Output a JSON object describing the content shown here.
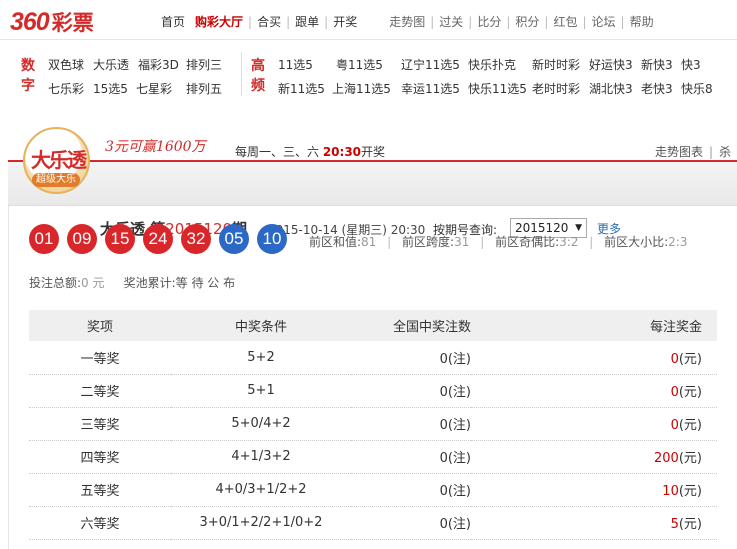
{
  "logo": {
    "num": "360",
    "text": "彩票"
  },
  "nav": [
    "首页",
    "购彩大厅",
    "合买",
    "跟单",
    "开奖",
    "走势图",
    "过关",
    "比分",
    "积分",
    "红包",
    "论坛",
    "帮助"
  ],
  "categories": {
    "digital_heading": "数字",
    "digital_row1": [
      "双色球",
      "大乐透",
      "福彩3D",
      "排列三"
    ],
    "digital_row2": [
      "七乐彩",
      "15选5",
      "七星彩",
      "排列五"
    ],
    "fast_heading": "高频",
    "fast_row1": [
      "11选5",
      "粤11选5",
      "辽宁11选5",
      "快乐扑克",
      "新时时彩",
      "好运快3",
      "新快3",
      "快3"
    ],
    "fast_row2": [
      "新11选5",
      "上海11选5",
      "幸运11选5",
      "快乐11选5",
      "老时时彩",
      "湖北快3",
      "老快3",
      "快乐8"
    ]
  },
  "header": {
    "badge_main": "大乐透",
    "badge_sub": "超级大乐",
    "slogan": "3元可赢1600万",
    "draw_days": "每周一、三、六 ",
    "draw_time": "20:30",
    "draw_suffix": "开奖",
    "trend": "走势图表",
    "trend_extra": "杀",
    "issue_prefix": "大乐透  第",
    "issue_no": "2015120",
    "issue_suffix": "期",
    "issue_date": "2015-10-14 (星期三) 20:30",
    "query_label": "按期号查询:",
    "query_value": "2015120",
    "more": "更多"
  },
  "draw": {
    "red_balls": [
      "01",
      "09",
      "15",
      "24",
      "32"
    ],
    "blue_balls": [
      "05",
      "10"
    ],
    "stats": {
      "sum_label": "前区和值:",
      "sum": "81",
      "span_label": "前区跨度:",
      "span": "31",
      "parity_label": "前区奇偶比:",
      "parity": "3:2",
      "size_label": "前区大小比:",
      "size": "2:3"
    },
    "sales_label": "投注总额:",
    "sales": "0 元",
    "pool_label": "奖池累计:",
    "pool": "等 待 公 布"
  },
  "prize_table": {
    "headers": [
      "奖项",
      "中奖条件",
      "全国中奖注数",
      "每注奖金"
    ],
    "rows": [
      {
        "level": "一等奖",
        "cond": "5+2",
        "count": "0",
        "count_unit": "(注)",
        "amount": "0",
        "amount_unit": "(元)"
      },
      {
        "level": "二等奖",
        "cond": "5+1",
        "count": "0",
        "count_unit": "(注)",
        "amount": "0",
        "amount_unit": "(元)"
      },
      {
        "level": "三等奖",
        "cond": "5+0/4+2",
        "count": "0",
        "count_unit": "(注)",
        "amount": "0",
        "amount_unit": "(元)"
      },
      {
        "level": "四等奖",
        "cond": "4+1/3+2",
        "count": "0",
        "count_unit": "(注)",
        "amount": "200",
        "amount_unit": "(元)"
      },
      {
        "level": "五等奖",
        "cond": "4+0/3+1/2+2",
        "count": "0",
        "count_unit": "(注)",
        "amount": "10",
        "amount_unit": "(元)"
      },
      {
        "level": "六等奖",
        "cond": "3+0/1+2/2+1/0+2",
        "count": "0",
        "count_unit": "(注)",
        "amount": "5",
        "amount_unit": "(元)"
      }
    ]
  },
  "colors": {
    "brand_red": "#d42a2a",
    "ball_red": "#d9262a",
    "ball_blue": "#2c68c6",
    "link_blue": "#2a6ebd"
  }
}
